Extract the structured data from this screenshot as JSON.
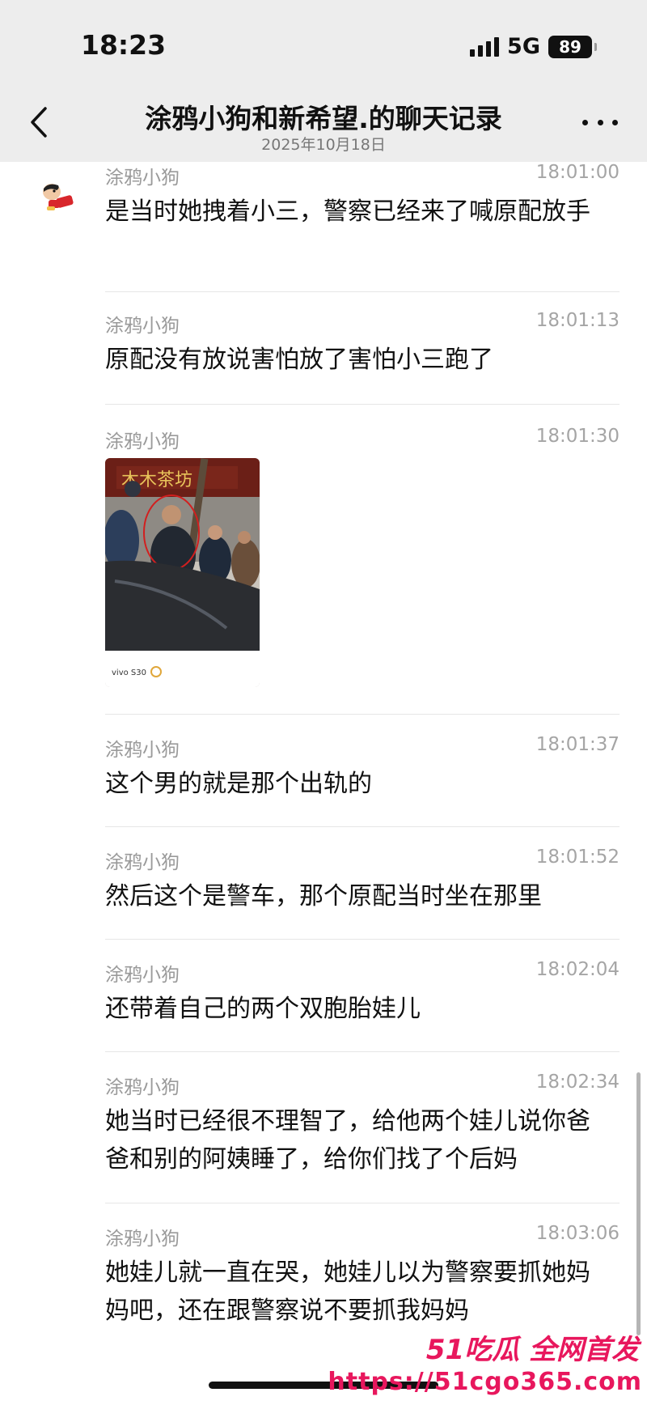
{
  "status": {
    "time": "18:23",
    "network": "5G",
    "battery": "89"
  },
  "header": {
    "title": "涂鸦小狗和新希望.的聊天记录",
    "date": "2025年10月18日"
  },
  "messages": [
    {
      "sender": "涂鸦小狗",
      "time": "18:01:00",
      "text": "是当时她拽着小三，警察已经来了喊原配放手"
    },
    {
      "sender": "涂鸦小狗",
      "time": "18:01:13",
      "text": "原配没有放说害怕放了害怕小三跑了"
    },
    {
      "sender": "涂鸦小狗",
      "time": "18:01:30",
      "image_caption": "vivo S30"
    },
    {
      "sender": "涂鸦小狗",
      "time": "18:01:37",
      "text": "这个男的就是那个出轨的"
    },
    {
      "sender": "涂鸦小狗",
      "time": "18:01:52",
      "text": "然后这个是警车，那个原配当时坐在那里"
    },
    {
      "sender": "涂鸦小狗",
      "time": "18:02:04",
      "text": "还带着自己的两个双胞胎娃儿"
    },
    {
      "sender": "涂鸦小狗",
      "time": "18:02:34",
      "text": "她当时已经很不理智了，给他两个娃儿说你爸爸和别的阿姨睡了，给你们找了个后妈"
    },
    {
      "sender": "涂鸦小狗",
      "time": "18:03:06",
      "text": "她娃儿就一直在哭，她娃儿以为警察要抓她妈妈吧，还在跟警察说不要抓我妈妈"
    }
  ],
  "watermark": {
    "logo": "51吃瓜 全网首发",
    "url": "https://51cgo365.com"
  },
  "icons": {
    "back": "chevron-left-icon",
    "more": "more-dots-icon",
    "avatar": "cartoon-avatar-icon"
  },
  "colors": {
    "header_bg": "#ededed",
    "watermark": "#e8175d",
    "meta_text": "#9a9a9a"
  }
}
